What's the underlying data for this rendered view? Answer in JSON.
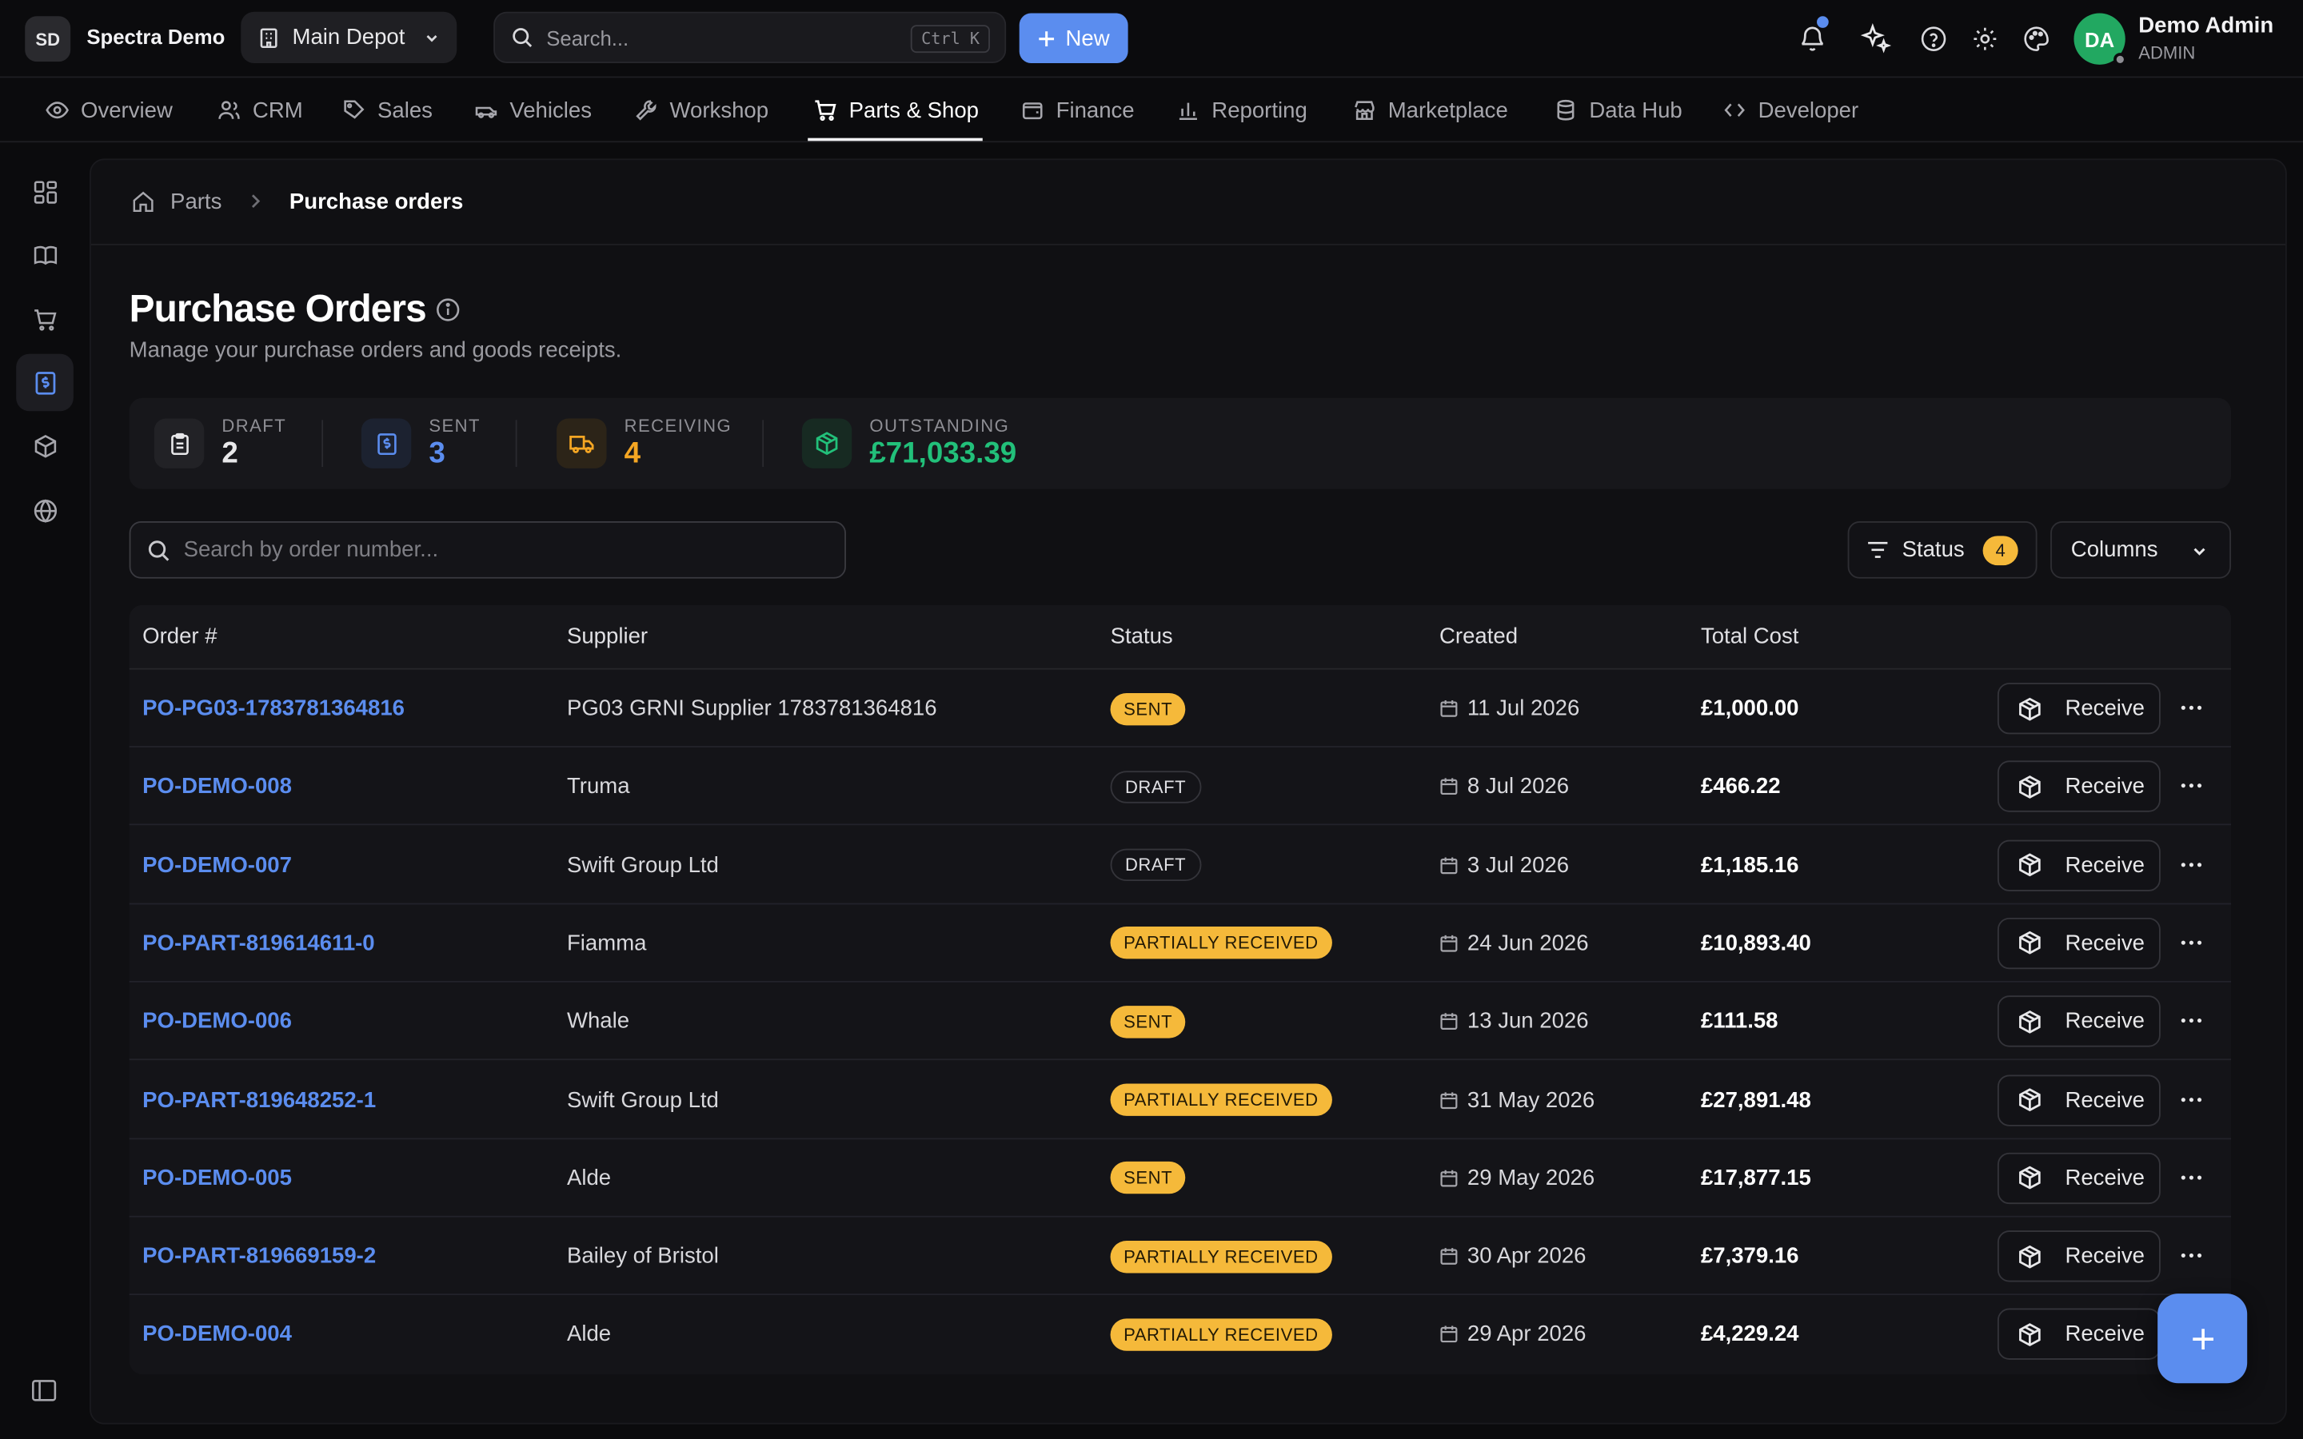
{
  "org": {
    "initials": "SD",
    "name": "Spectra Demo"
  },
  "depot": {
    "label": "Main Depot"
  },
  "search": {
    "placeholder": "Search...",
    "shortcut": "Ctrl K"
  },
  "new_button": {
    "label": "New"
  },
  "user": {
    "initials": "DA",
    "name": "Demo Admin",
    "role": "ADMIN"
  },
  "nav": {
    "items": [
      {
        "label": "Overview",
        "icon": "eye-icon"
      },
      {
        "label": "CRM",
        "icon": "users-icon"
      },
      {
        "label": "Sales",
        "icon": "tag-icon"
      },
      {
        "label": "Vehicles",
        "icon": "car-icon"
      },
      {
        "label": "Workshop",
        "icon": "wrench-icon"
      },
      {
        "label": "Parts & Shop",
        "icon": "cart-icon",
        "active": true
      },
      {
        "label": "Finance",
        "icon": "wallet-icon"
      },
      {
        "label": "Reporting",
        "icon": "bar-chart-icon"
      },
      {
        "label": "Marketplace",
        "icon": "store-icon"
      },
      {
        "label": "Data Hub",
        "icon": "database-icon"
      },
      {
        "label": "Developer",
        "icon": "code-icon"
      }
    ]
  },
  "rail": [
    "grid-icon",
    "book-icon",
    "cart-icon",
    "receipt-icon",
    "box-icon",
    "globe-icon"
  ],
  "breadcrumb": {
    "root": "Parts",
    "current": "Purchase orders"
  },
  "page": {
    "title": "Purchase Orders",
    "subtitle": "Manage your purchase orders and goods receipts."
  },
  "stats": [
    {
      "label": "Draft",
      "value": "2",
      "color": "#e8e8ea",
      "icon": "clipboard-icon"
    },
    {
      "label": "Sent",
      "value": "3",
      "color": "#5b8def",
      "icon": "receipt-icon"
    },
    {
      "label": "Receiving",
      "value": "4",
      "color": "#f5a623",
      "icon": "truck-icon"
    },
    {
      "label": "Outstanding",
      "value": "£71,033.39",
      "color": "#22c07a",
      "icon": "package-icon"
    }
  ],
  "filters": {
    "search_placeholder": "Search by order number...",
    "status_label": "Status",
    "status_count": "4",
    "columns_label": "Columns"
  },
  "table": {
    "columns": [
      "Order #",
      "Supplier",
      "Status",
      "Created",
      "Total Cost"
    ],
    "receive_label": "Receive",
    "rows": [
      {
        "order": "PO-PG03-1783781364816",
        "supplier": "PG03 GRNI Supplier 1783781364816",
        "status": "SENT",
        "status_kind": "sent",
        "created": "11 Jul 2026",
        "total": "£1,000.00"
      },
      {
        "order": "PO-DEMO-008",
        "supplier": "Truma",
        "status": "DRAFT",
        "status_kind": "draft",
        "created": "8 Jul 2026",
        "total": "£466.22"
      },
      {
        "order": "PO-DEMO-007",
        "supplier": "Swift Group Ltd",
        "status": "DRAFT",
        "status_kind": "draft",
        "created": "3 Jul 2026",
        "total": "£1,185.16"
      },
      {
        "order": "PO-PART-819614611-0",
        "supplier": "Fiamma",
        "status": "PARTIALLY RECEIVED",
        "status_kind": "partial",
        "created": "24 Jun 2026",
        "total": "£10,893.40"
      },
      {
        "order": "PO-DEMO-006",
        "supplier": "Whale",
        "status": "SENT",
        "status_kind": "sent",
        "created": "13 Jun 2026",
        "total": "£111.58"
      },
      {
        "order": "PO-PART-819648252-1",
        "supplier": "Swift Group Ltd",
        "status": "PARTIALLY RECEIVED",
        "status_kind": "partial",
        "created": "31 May 2026",
        "total": "£27,891.48"
      },
      {
        "order": "PO-DEMO-005",
        "supplier": "Alde",
        "status": "SENT",
        "status_kind": "sent",
        "created": "29 May 2026",
        "total": "£17,877.15"
      },
      {
        "order": "PO-PART-819669159-2",
        "supplier": "Bailey of Bristol",
        "status": "PARTIALLY RECEIVED",
        "status_kind": "partial",
        "created": "30 Apr 2026",
        "total": "£7,379.16"
      },
      {
        "order": "PO-DEMO-004",
        "supplier": "Alde",
        "status": "PARTIALLY RECEIVED",
        "status_kind": "partial",
        "created": "29 Apr 2026",
        "total": "£4,229.24"
      }
    ]
  },
  "colors": {
    "accent": "#5b8def",
    "warning": "#f5b93a",
    "success": "#22c07a"
  }
}
